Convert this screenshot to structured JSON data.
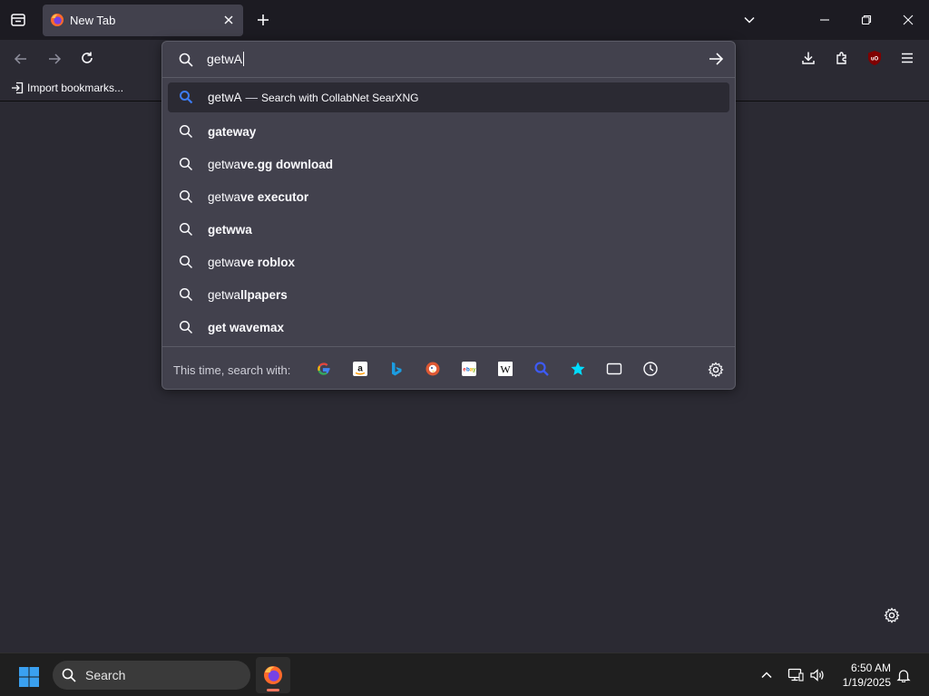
{
  "window": {
    "tab": {
      "title": "New Tab"
    }
  },
  "bookmarks_bar": {
    "import_label": "Import bookmarks..."
  },
  "urlbar": {
    "value": "getwA",
    "heuristic": {
      "query": "getwA",
      "separator": "—",
      "action": "Search with CollabNet SearXNG"
    },
    "suggestions": [
      {
        "typed": "",
        "completion": "gateway"
      },
      {
        "typed": "getwa",
        "completion": "ve.gg download"
      },
      {
        "typed": "getwa",
        "completion": "ve executor"
      },
      {
        "typed": "",
        "completion": "getwwa"
      },
      {
        "typed": "getwa",
        "completion": "ve roblox"
      },
      {
        "typed": "getwa",
        "completion": "llpapers"
      },
      {
        "typed": "",
        "completion": "get wavemax"
      }
    ],
    "oneoff_label": "This time, search with:",
    "engines": [
      "google-icon",
      "amazon-icon",
      "bing-icon",
      "duckduckgo-icon",
      "ebay-icon",
      "wikipedia-icon",
      "searxng-icon",
      "bookmarks-star-icon",
      "tabs-icon",
      "history-icon"
    ]
  },
  "taskbar": {
    "search_placeholder": "Search",
    "time": "6:50 AM",
    "date": "1/19/2025"
  },
  "colors": {
    "accent": "#3d7cf5",
    "panel": "#42414d",
    "page": "#2b2a33",
    "chrome": "#1c1b22"
  }
}
